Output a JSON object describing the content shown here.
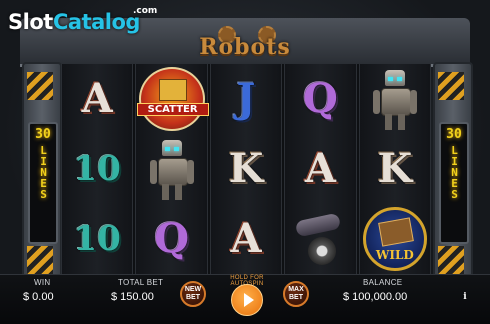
{
  "watermark": {
    "slot": "Slot",
    "catalog": "Catalog",
    "com": ".com"
  },
  "game": {
    "title": "Robots"
  },
  "side_panels": {
    "lines_number": "30",
    "lines_word": "LINES"
  },
  "reels": [
    [
      "A",
      "10",
      "10"
    ],
    [
      "SCATTER",
      "ROBOT",
      "Q"
    ],
    [
      "J",
      "K",
      "A"
    ],
    [
      "Q",
      "A",
      "VEHICLE"
    ],
    [
      "ROBOT",
      "K",
      "WILD"
    ]
  ],
  "symbols": {
    "scatter_label": "SCATTER",
    "wild_label": "WILD"
  },
  "bottom_bar": {
    "win_label": "WIN",
    "win_value": "$ 0.00",
    "total_bet_label": "TOTAL BET",
    "total_bet_value": "$ 150.00",
    "new_bet_label": "NEW BET",
    "hold_label": "HOLD FOR AUTOSPIN",
    "max_bet_label": "MAX BET",
    "balance_label": "BALANCE",
    "balance_value": "$ 100,000.00",
    "info_label": "i"
  },
  "colors": {
    "accent": "#e8700a",
    "lines_text": "#f2d21c",
    "title": "#c88a3c"
  }
}
